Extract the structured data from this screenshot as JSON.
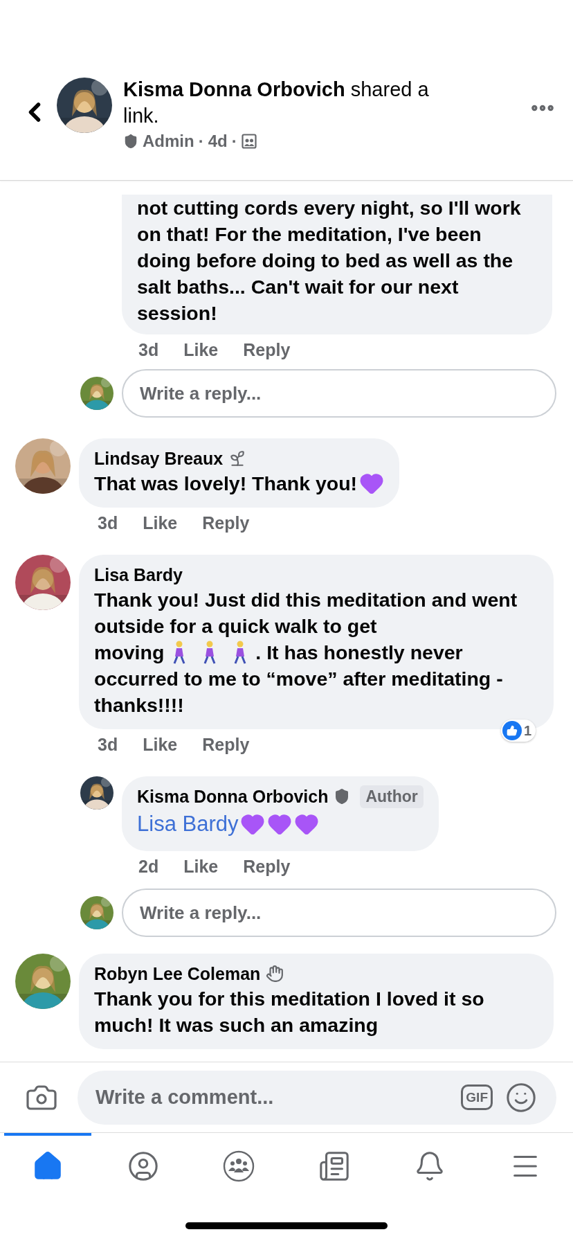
{
  "header": {
    "title": "**Kisma Donna Orbovich** shared a link.",
    "role": "Admin",
    "separator": "·",
    "time": "4d"
  },
  "thread": [
    {
      "kind": "continued_comment",
      "nested": true,
      "lines": [
        [
          {
            "kind": "text",
            "text": "not cutting cords every night, so I'll work on that! For the meditation, I've been doing before doing to bed as well as the salt baths... Can't wait for our next session!"
          }
        ]
      ],
      "time": "3d",
      "actions": [
        "Like",
        "Reply"
      ]
    },
    {
      "kind": "reply_field",
      "placeholder": "Write a reply..."
    },
    {
      "kind": "comment",
      "nested": false,
      "author": "Lindsay Breaux",
      "badge": {
        "kind": "sprout"
      },
      "lines": [
        [
          {
            "kind": "text",
            "text": "That was lovely! Thank you!"
          },
          {
            "kind": "heart"
          }
        ]
      ],
      "time": "3d",
      "actions": [
        "Like",
        "Reply"
      ]
    },
    {
      "kind": "comment",
      "nested": false,
      "author": "Lisa Bardy",
      "lines": [
        [
          {
            "kind": "text",
            "text": "Thank you! Just did this meditation and went outside for a quick walk to get"
          }
        ],
        [
          {
            "kind": "text",
            "text": "moving"
          },
          {
            "kind": "walker"
          },
          {
            "kind": "walker"
          },
          {
            "kind": "walker"
          },
          {
            "kind": "text",
            "text": ". It has honestly never"
          }
        ],
        [
          {
            "kind": "text",
            "text": "occurred to me to “move” after meditating - thanks!!!!"
          }
        ]
      ],
      "reactions": {
        "count": "1"
      },
      "time": "3d",
      "actions": [
        "Like",
        "Reply"
      ]
    },
    {
      "kind": "comment",
      "nested": true,
      "author": "Kisma Donna Orbovich",
      "badge": {
        "kind": "admin"
      },
      "tag": "Author",
      "lines": [
        [
          {
            "kind": "mention",
            "text": "Lisa Bardy"
          },
          {
            "kind": "heart"
          },
          {
            "kind": "heart"
          },
          {
            "kind": "heart"
          }
        ]
      ],
      "time": "2d",
      "actions": [
        "Like",
        "Reply"
      ]
    },
    {
      "kind": "reply_field",
      "placeholder": "Write a reply..."
    },
    {
      "kind": "comment",
      "nested": false,
      "author": "Robyn Lee Coleman",
      "badge": {
        "kind": "wave"
      },
      "lines": [
        [
          {
            "kind": "text",
            "text": "Thank you for this meditation I loved it so much! It was such an amazing"
          }
        ]
      ]
    }
  ],
  "composer": {
    "placeholder": "Write a comment...",
    "gif_label": "GIF"
  },
  "tabs": [
    {
      "kind": "home",
      "selected": true
    },
    {
      "kind": "profile",
      "selected": false
    },
    {
      "kind": "groups",
      "selected": false
    },
    {
      "kind": "news",
      "selected": false
    },
    {
      "kind": "bell",
      "selected": false
    },
    {
      "kind": "menu",
      "selected": false
    }
  ]
}
